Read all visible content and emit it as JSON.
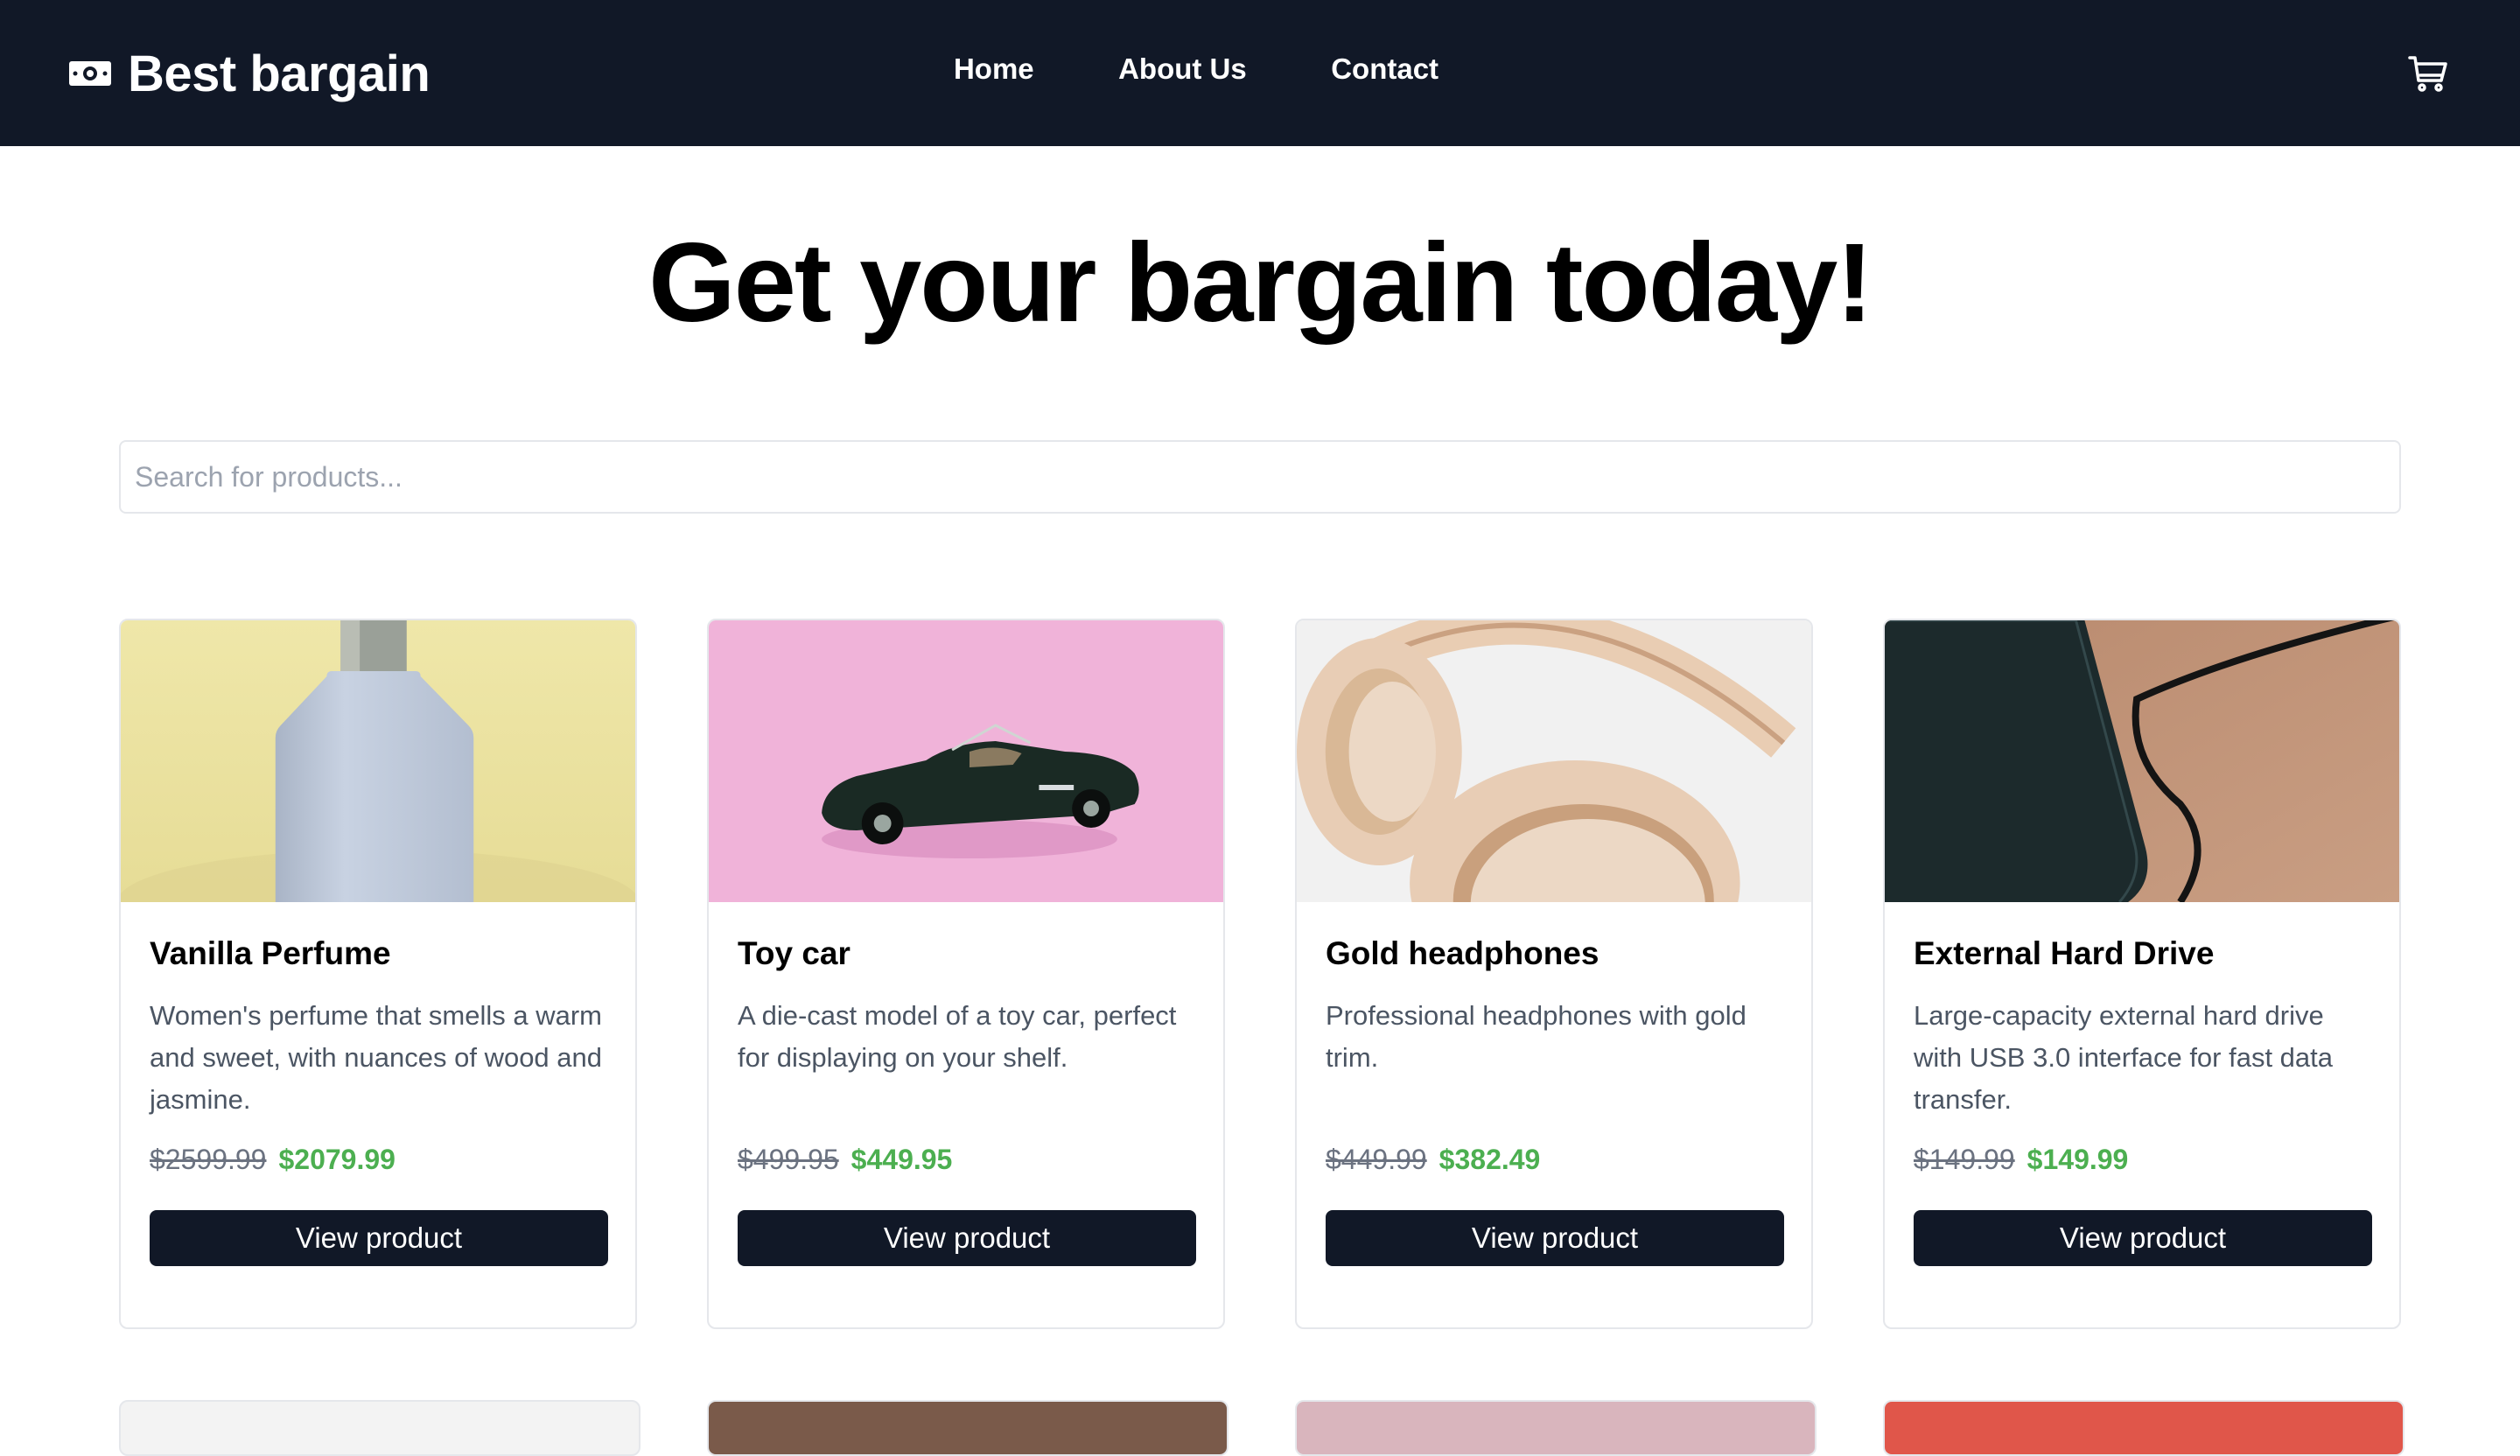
{
  "brand": {
    "name": "Best bargain",
    "icon": "money-bill-icon"
  },
  "nav": {
    "links": [
      "Home",
      "About Us",
      "Contact"
    ],
    "cart_icon": "cart-icon"
  },
  "hero": {
    "title": "Get your bargain today!"
  },
  "search": {
    "placeholder": "Search for products..."
  },
  "products": [
    {
      "name": "Vanilla Perfume",
      "description": "Women's perfume that smells a warm and sweet, with nuances of wood and jasmine.",
      "old_price": "$2599.99",
      "new_price": "$2079.99",
      "button": "View product",
      "image": "perfume-bottle-photo"
    },
    {
      "name": "Toy car",
      "description": "A die-cast model of a toy car, perfect for displaying on your shelf.",
      "old_price": "$499.95",
      "new_price": "$449.95",
      "button": "View product",
      "image": "toy-car-photo"
    },
    {
      "name": "Gold headphones",
      "description": "Professional headphones with gold trim.",
      "old_price": "$449.99",
      "new_price": "$382.49",
      "button": "View product",
      "image": "headphones-photo"
    },
    {
      "name": "External Hard Drive",
      "description": "Large-capacity external hard drive with USB 3.0 interface for fast data transfer.",
      "old_price": "$149.99",
      "new_price": "$149.99",
      "button": "View product",
      "image": "hard-drive-photo"
    }
  ],
  "colors": {
    "navbar": "#111827",
    "accent_price": "#4caf50",
    "button": "#111827"
  }
}
